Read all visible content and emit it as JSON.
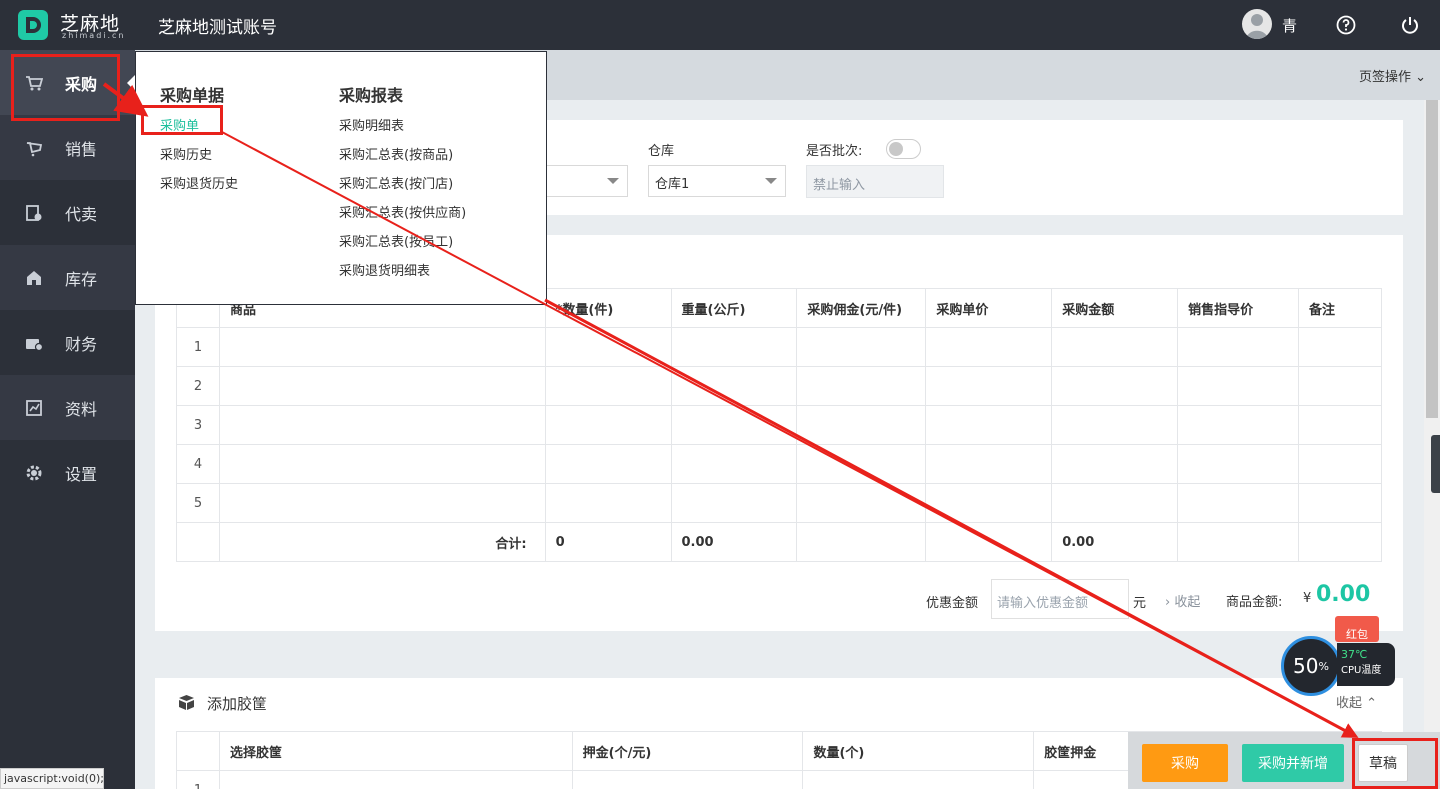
{
  "header": {
    "brand": "芝麻地",
    "brand_sub": "zhimadi.cn",
    "account": "芝麻地测试账号",
    "user_name": "青",
    "icons": [
      "help-icon",
      "power-icon"
    ]
  },
  "sidebar": {
    "items": [
      {
        "label": "采购",
        "icon": "cart-icon"
      },
      {
        "label": "销售",
        "icon": "sale-icon"
      },
      {
        "label": "代卖",
        "icon": "consign-icon"
      },
      {
        "label": "库存",
        "icon": "warehouse-icon"
      },
      {
        "label": "财务",
        "icon": "finance-icon"
      },
      {
        "label": "资料",
        "icon": "data-icon"
      },
      {
        "label": "设置",
        "icon": "gear-icon"
      }
    ]
  },
  "tabbar": {
    "op_label": "页签操作"
  },
  "filters": {
    "warehouse_label": "仓库",
    "warehouse_value": "仓库1",
    "batch_label": "是否批次:",
    "batch_input_placeholder": "禁止输入"
  },
  "menu": {
    "col1_title": "采购单据",
    "col1_items": [
      "采购单",
      "采购历史",
      "采购退货历史"
    ],
    "col2_title": "采购报表",
    "col2_items": [
      "采购明细表",
      "采购汇总表(按商品)",
      "采购汇总表(按门店)",
      "采购汇总表(按供应商)",
      "采购汇总表(按员工)",
      "采购退货明细表"
    ]
  },
  "main_table": {
    "headers": [
      "",
      "商品",
      "*数量(件)",
      "重量(公斤)",
      "采购佣金(元/件)",
      "采购单价",
      "采购金额",
      "销售指导价",
      "备注"
    ],
    "rows": [
      "1",
      "2",
      "3",
      "4",
      "5"
    ],
    "total_label": "合计:",
    "total_qty": "0",
    "total_weight": "0.00",
    "total_amount": "0.00"
  },
  "summary": {
    "discount_label": "优惠金额",
    "discount_placeholder": "请输入优惠金额",
    "unit": "元",
    "collapse_label": "收起",
    "goods_amount_label": "商品金额:",
    "currency": "¥",
    "goods_amount": "0.00"
  },
  "crate": {
    "title": "添加胶筐",
    "collapse_label": "收起",
    "headers": [
      "",
      "选择胶筐",
      "押金(个/元)",
      "数量(个)",
      "胶筐押金"
    ],
    "first_row": "1"
  },
  "buttons": {
    "buy": "采购",
    "buy_new": "采购并新增",
    "draft": "草稿"
  },
  "widget": {
    "cpu_percent": "50",
    "percent_sign": "%",
    "temp": "37℃",
    "temp_label": "CPU温度",
    "red_packet": "红包"
  },
  "status_bar": "javascript:void(0);",
  "colors": {
    "accent": "#1dc6a4",
    "orange": "#ff9a12",
    "annotation": "#e8211b",
    "sidebar": "#2c3039"
  }
}
